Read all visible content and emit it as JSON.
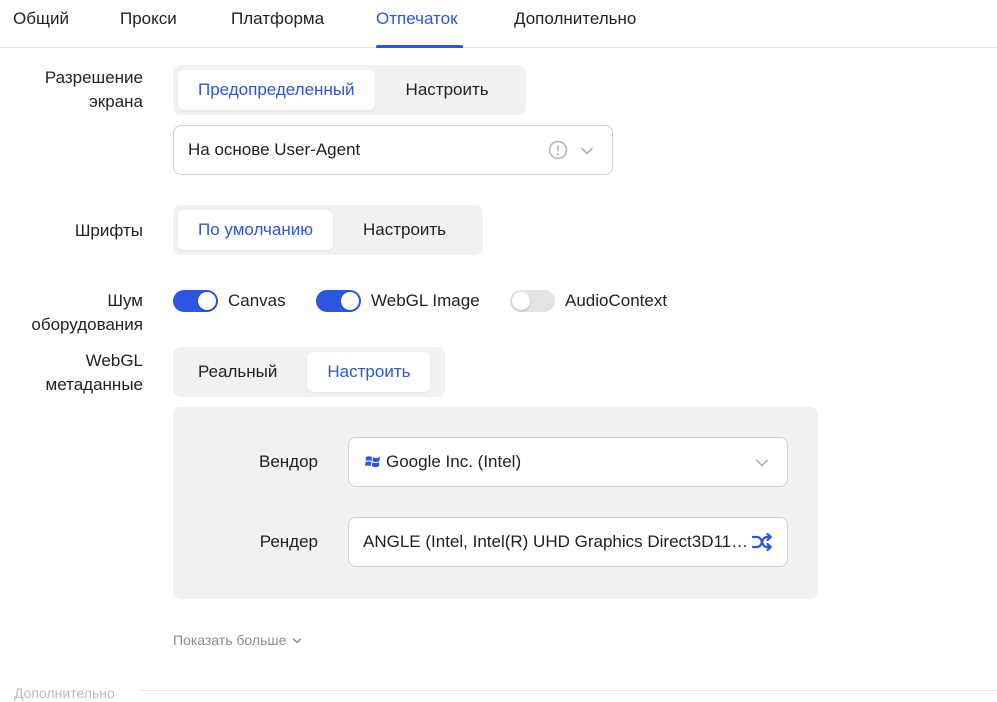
{
  "tabs": [
    {
      "label": "Общий",
      "active": false
    },
    {
      "label": "Прокси",
      "active": false
    },
    {
      "label": "Платформа",
      "active": false
    },
    {
      "label": "Отпечаток",
      "active": true
    },
    {
      "label": "Дополнительно",
      "active": false
    }
  ],
  "screen_resolution": {
    "label_line1": "Разрешение",
    "label_line2": "экрана",
    "options": [
      "Предопределенный",
      "Настроить"
    ],
    "selected": "Предопределенный",
    "select_value": "На основе User-Agent"
  },
  "fonts": {
    "label": "Шрифты",
    "options": [
      "По умолчанию",
      "Настроить"
    ],
    "selected": "По умолчанию"
  },
  "hardware_noise": {
    "label_line1": "Шум",
    "label_line2": "оборудования",
    "toggles": [
      {
        "label": "Canvas",
        "on": true
      },
      {
        "label": "WebGL Image",
        "on": true
      },
      {
        "label": "AudioContext",
        "on": false
      }
    ]
  },
  "webgl_metadata": {
    "label_line1": "WebGL",
    "label_line2": "метаданные",
    "options": [
      "Реальный",
      "Настроить"
    ],
    "selected": "Настроить",
    "vendor_label": "Вендор",
    "vendor_value": "Google Inc. (Intel)",
    "vendor_icon": "windows-icon",
    "renderer_label": "Рендер",
    "renderer_value": "ANGLE (Intel, Intel(R) UHD Graphics Direct3D11…",
    "renderer_icon": "shuffle-icon"
  },
  "show_more": "Показать больше",
  "next_section_cut": "Дополнительно",
  "accent_color": "#2c55e0"
}
